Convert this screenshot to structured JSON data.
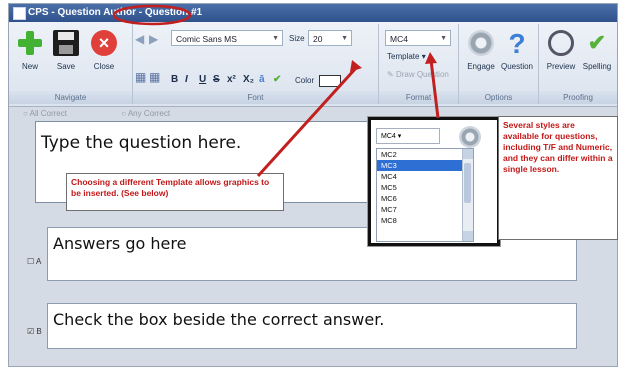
{
  "titlebar": {
    "title": "CPS - Question Author - Question #1"
  },
  "ribbon": {
    "navigate": {
      "group_label": "Navigate",
      "new_label": "New",
      "save_label": "Save",
      "close_label": "Close"
    },
    "font": {
      "group_label": "Font",
      "font_name": "Comic Sans MS",
      "size_label": "Size",
      "size_value": "20",
      "bold": "B",
      "italic": "I",
      "underline": "U",
      "strike": "S",
      "superscript": "x²",
      "subscript": "X₂",
      "color_label": "Color"
    },
    "format": {
      "group_label": "Format",
      "template_value": "MC4",
      "template_label": "Template",
      "draw_question": "Draw Question"
    },
    "options": {
      "group_label": "Options",
      "engage_label": "Engage",
      "question_label": "Question"
    },
    "proofing": {
      "group_label": "Proofing",
      "preview_label": "Preview",
      "spelling_label": "Spelling"
    }
  },
  "editor": {
    "radio_all": "All Correct",
    "radio_any": "Any Correct",
    "question_text": "Type the question here.",
    "answers": [
      {
        "letter": "A",
        "checked": false,
        "text": "Answers go here"
      },
      {
        "letter": "B",
        "checked": true,
        "text": "Check the box beside the correct answer."
      }
    ]
  },
  "template_dropdown": {
    "selected": "MC4",
    "options": [
      "MC2",
      "MC3",
      "MC4",
      "MC5",
      "MC6",
      "MC7",
      "MC8"
    ],
    "highlighted": "MC3"
  },
  "annotations": {
    "template_note": "Choosing a different Template allows graphics to be inserted. (See below)",
    "styles_note": "Several styles are available for questions, including T/F and Numeric, and they can differ within a single lesson."
  },
  "colors": {
    "accent": "#2d6fd2",
    "annotation_red": "#c21717",
    "arrow_red": "#c21f1f"
  }
}
